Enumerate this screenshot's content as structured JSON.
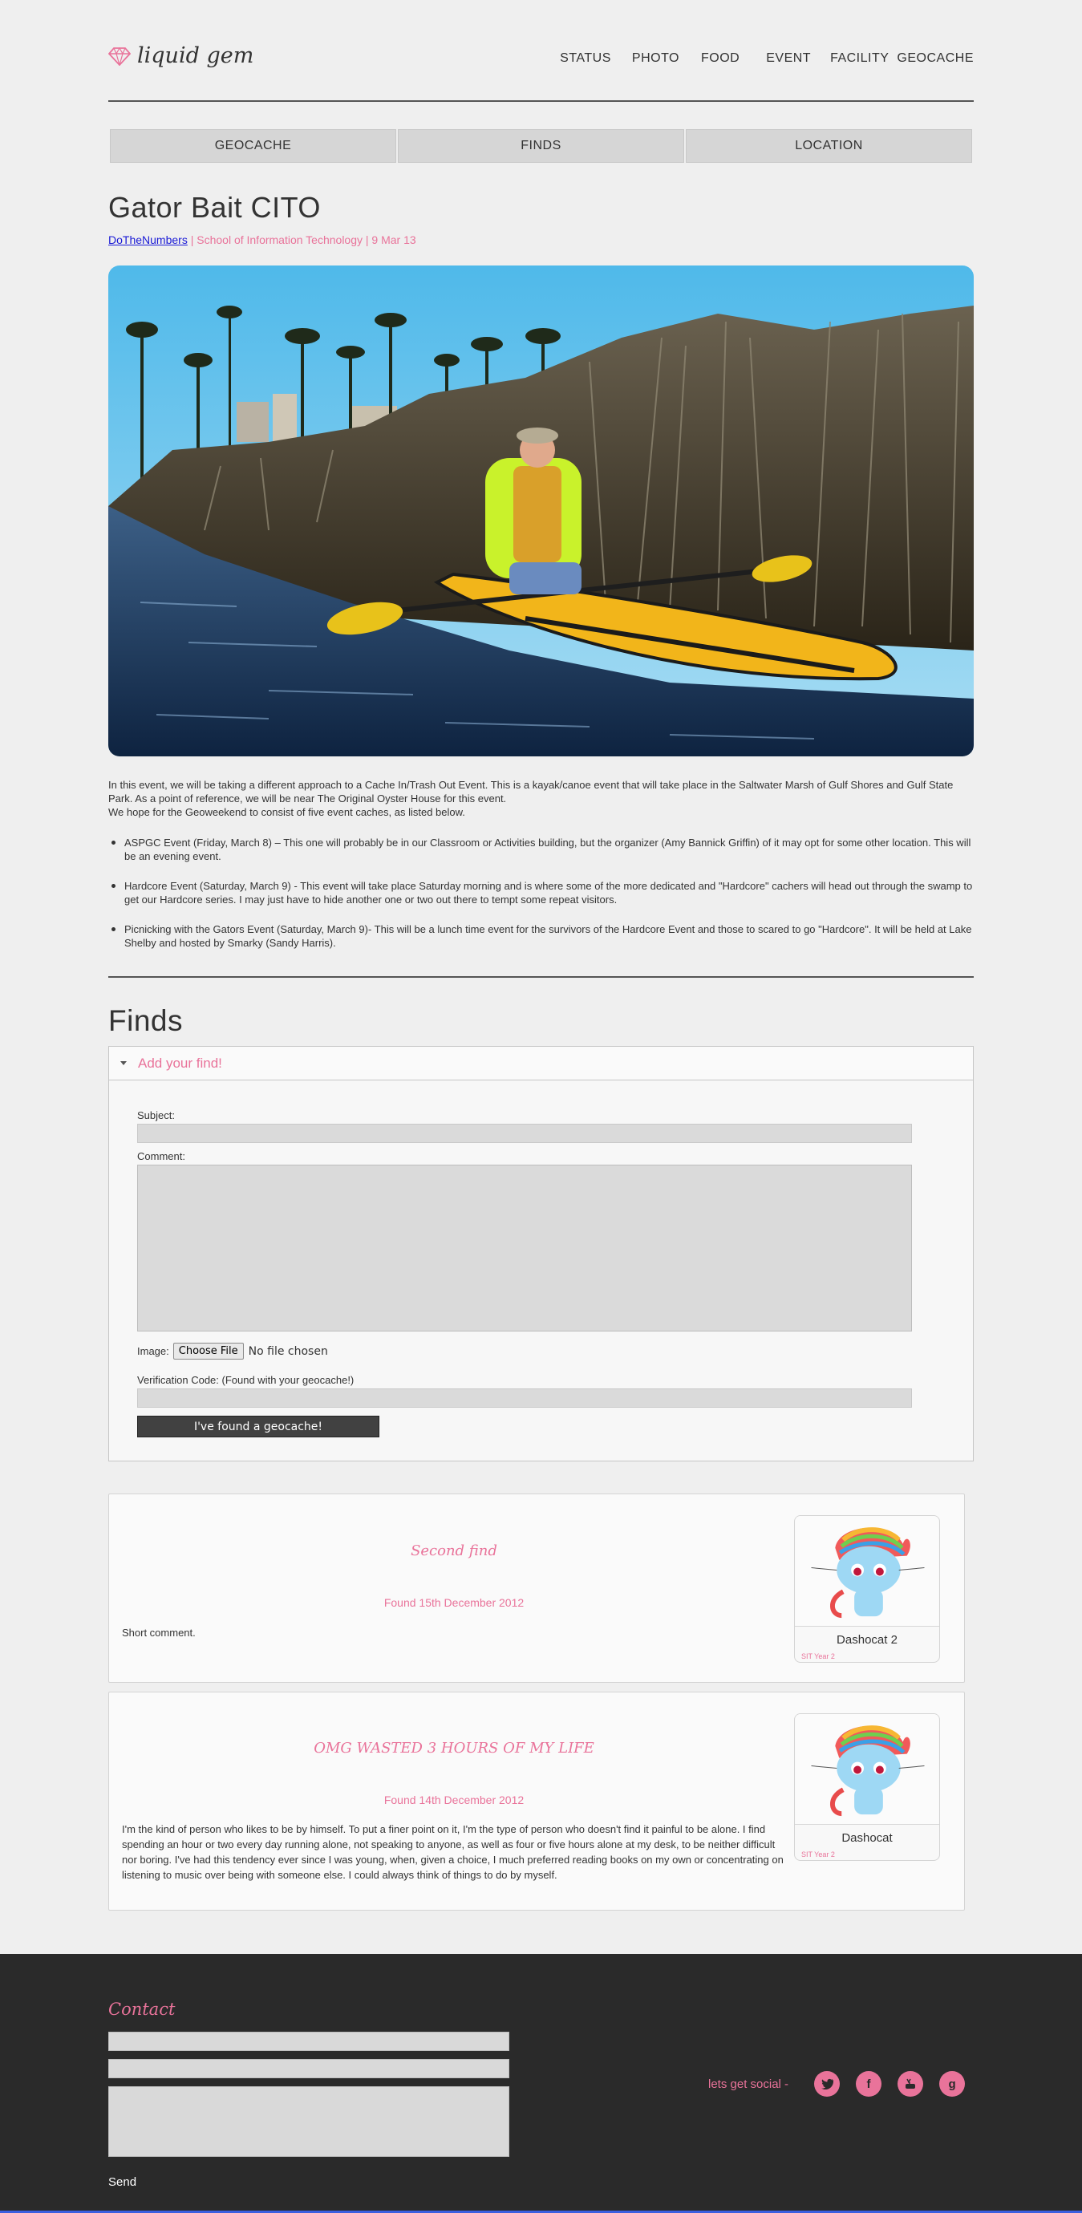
{
  "brand": {
    "name": "liquid gem",
    "accent": "#e9739a"
  },
  "nav": [
    "STATUS",
    "PHOTO",
    "FOOD",
    "EVENT",
    "FACILITY",
    "GEOCACHE"
  ],
  "tabs": [
    "GEOCACHE",
    "FINDS",
    "LOCATION"
  ],
  "article": {
    "title": "Gator Bait CITO",
    "author": "DoTheNumbers",
    "meta": " | School of Information Technology | 9 Mar 13",
    "intro": [
      "In this event, we will be taking a different approach to a Cache In/Trash Out Event. This is a kayak/canoe event that will take place in the Saltwater Marsh of Gulf Shores and Gulf State Park. As a point of reference, we will be near The Original Oyster House for this event.",
      "We hope for the Geoweekend to consist of five event caches, as listed below."
    ],
    "events": [
      "ASPGC Event (Friday, March 8) – This one will probably be in our Classroom or Activities building, but the organizer (Amy Bannick Griffin) of it may opt for some other location. This will be an evening event.",
      "Hardcore Event (Saturday, March 9) - This event will take place Saturday morning and is where some of the more dedicated and \"Hardcore\" cachers will head out through the swamp to get our Hardcore series. I may just have to hide another one or two out there to tempt some repeat visitors.",
      "Picnicking with the Gators Event (Saturday, March 9)- This will be a lunch time event for the survivors of the Hardcore Event and those to scared to go \"Hardcore\". It will be held at Lake Shelby and hosted by Smarky (Sandy Harris)."
    ]
  },
  "finds": {
    "heading": "Finds",
    "panel_title": "Add your find!",
    "form": {
      "subject_label": "Subject:",
      "comment_label": "Comment:",
      "image_label": "Image:",
      "file_button": "Choose File",
      "file_status": "No file chosen",
      "verification_label": "Verification Code: (Found with your geocache!)",
      "submit": "I've found a geocache!"
    },
    "entries": [
      {
        "subject": "Second find",
        "date": "Found 15th December 2012",
        "comment": "Short comment.",
        "user": "Dashocat 2",
        "user_sub": "SIT Year 2"
      },
      {
        "subject": "OMG WASTED 3 HOURS OF MY LIFE",
        "date": "Found 14th December 2012",
        "comment": "I'm the kind of person who likes to be by himself. To put a finer point on it, I'm the type of person who doesn't find it painful to be alone. I find spending an hour or two every day running alone, not speaking to anyone, as well as four or five hours alone at my desk, to be neither difficult nor boring. I've had this tendency ever since I was young, when, given a choice, I much preferred reading books on my own or concentrating on listening to music over being with someone else. I could always think of things to do by myself.",
        "user": "Dashocat",
        "user_sub": "SIT Year 2"
      }
    ]
  },
  "footer": {
    "contact_title": "Contact",
    "send": "Send",
    "social_label": "lets get social -",
    "social_icons": [
      "twitter-icon",
      "facebook-icon",
      "youtube-icon",
      "google-plus-icon"
    ]
  }
}
